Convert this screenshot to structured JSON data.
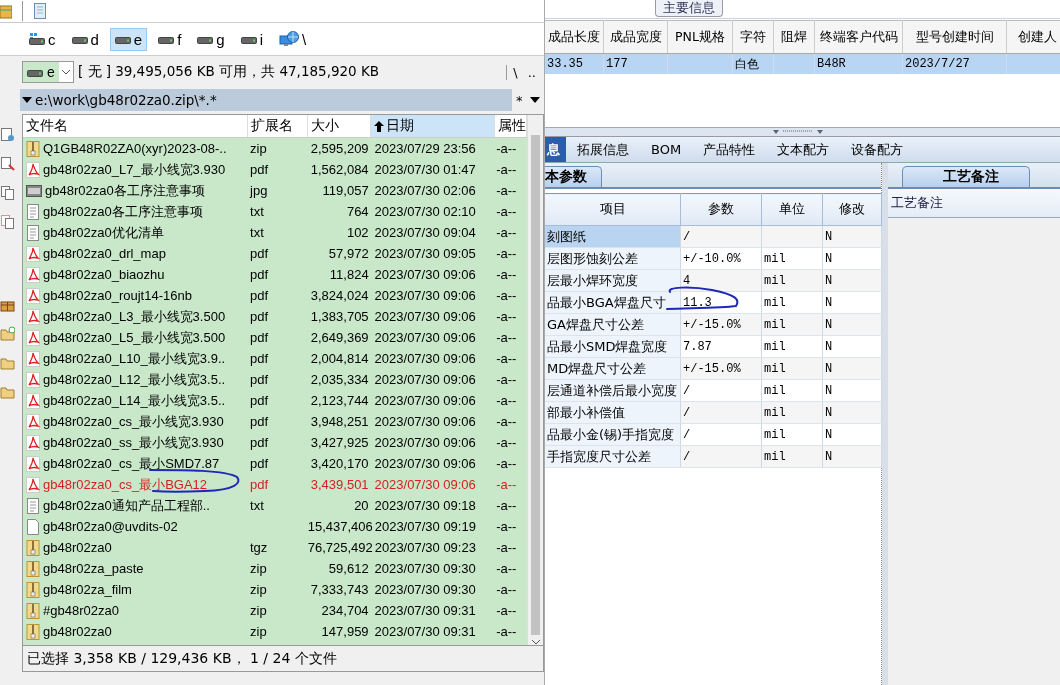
{
  "file_manager": {
    "drives": [
      {
        "label": "c",
        "kind": "system",
        "selected": false
      },
      {
        "label": "d",
        "kind": "disk",
        "selected": false
      },
      {
        "label": "e",
        "kind": "disk",
        "selected": true
      },
      {
        "label": "f",
        "kind": "disk",
        "selected": false
      },
      {
        "label": "g",
        "kind": "disk",
        "selected": false
      },
      {
        "label": "i",
        "kind": "disk",
        "selected": false
      },
      {
        "label": "\\",
        "kind": "network",
        "selected": false
      }
    ],
    "drive_combo": "e",
    "volume_label": "[ 无 ]",
    "free_space": "39,495,056 KB 可用，共 47,185,920 KB",
    "root_button": "\\",
    "up_button": "..",
    "path": "e:\\work\\gb48r02za0.zip\\*.*",
    "filter_button": "*",
    "columns": [
      {
        "label": "文件名",
        "sorted": false
      },
      {
        "label": "扩展名",
        "sorted": false
      },
      {
        "label": "大小",
        "sorted": false
      },
      {
        "label": "日期",
        "sorted": true
      },
      {
        "label": "属性",
        "sorted": false
      }
    ],
    "files": [
      {
        "kind": "archive",
        "name": "Q1GB48R02ZA0(xyr)2023-08-..",
        "ext": "zip",
        "size": "2,595,209",
        "date": "2023/07/29 23:56",
        "attr": "-a--",
        "marked": false
      },
      {
        "kind": "pdf",
        "name": "gb48r02za0_L7_最小线宽3.930",
        "ext": "pdf",
        "size": "1,562,084",
        "date": "2023/07/30 01:47",
        "attr": "-a--",
        "marked": false
      },
      {
        "kind": "image",
        "name": "gb48r02za0各工序注意事项",
        "ext": "jpg",
        "size": "119,057",
        "date": "2023/07/30 02:06",
        "attr": "-a--",
        "marked": false
      },
      {
        "kind": "text",
        "name": "gb48r02za0各工序注意事项",
        "ext": "txt",
        "size": "764",
        "date": "2023/07/30 02:10",
        "attr": "-a--",
        "marked": false
      },
      {
        "kind": "text",
        "name": "gb48r02za0优化清单",
        "ext": "txt",
        "size": "102",
        "date": "2023/07/30 09:04",
        "attr": "-a--",
        "marked": false
      },
      {
        "kind": "pdf",
        "name": "gb48r02za0_drl_map",
        "ext": "pdf",
        "size": "57,972",
        "date": "2023/07/30 09:05",
        "attr": "-a--",
        "marked": false
      },
      {
        "kind": "pdf",
        "name": "gb48r02za0_biaozhu",
        "ext": "pdf",
        "size": "11,824",
        "date": "2023/07/30 09:06",
        "attr": "-a--",
        "marked": false
      },
      {
        "kind": "pdf",
        "name": "gb48r02za0_roujt14-16nb",
        "ext": "pdf",
        "size": "3,824,024",
        "date": "2023/07/30 09:06",
        "attr": "-a--",
        "marked": false
      },
      {
        "kind": "pdf",
        "name": "gb48r02za0_L3_最小线宽3.500",
        "ext": "pdf",
        "size": "1,383,705",
        "date": "2023/07/30 09:06",
        "attr": "-a--",
        "marked": false
      },
      {
        "kind": "pdf",
        "name": "gb48r02za0_L5_最小线宽3.500",
        "ext": "pdf",
        "size": "2,649,369",
        "date": "2023/07/30 09:06",
        "attr": "-a--",
        "marked": false
      },
      {
        "kind": "pdf",
        "name": "gb48r02za0_L10_最小线宽3.9..",
        "ext": "pdf",
        "size": "2,004,814",
        "date": "2023/07/30 09:06",
        "attr": "-a--",
        "marked": false
      },
      {
        "kind": "pdf",
        "name": "gb48r02za0_L12_最小线宽3.5..",
        "ext": "pdf",
        "size": "2,035,334",
        "date": "2023/07/30 09:06",
        "attr": "-a--",
        "marked": false
      },
      {
        "kind": "pdf",
        "name": "gb48r02za0_L14_最小线宽3.5..",
        "ext": "pdf",
        "size": "2,123,744",
        "date": "2023/07/30 09:06",
        "attr": "-a--",
        "marked": false
      },
      {
        "kind": "pdf",
        "name": "gb48r02za0_cs_最小线宽3.930",
        "ext": "pdf",
        "size": "3,948,251",
        "date": "2023/07/30 09:06",
        "attr": "-a--",
        "marked": false
      },
      {
        "kind": "pdf",
        "name": "gb48r02za0_ss_最小线宽3.930",
        "ext": "pdf",
        "size": "3,427,925",
        "date": "2023/07/30 09:06",
        "attr": "-a--",
        "marked": false
      },
      {
        "kind": "pdf",
        "name": "gb48r02za0_cs_最小SMD7.87",
        "ext": "pdf",
        "size": "3,420,170",
        "date": "2023/07/30 09:06",
        "attr": "-a--",
        "marked": false
      },
      {
        "kind": "pdf",
        "name": "gb48r02za0_cs_最小BGA12",
        "ext": "pdf",
        "size": "3,439,501",
        "date": "2023/07/30 09:06",
        "attr": "-a--",
        "marked": true
      },
      {
        "kind": "text",
        "name": "gb48r02za0通知产品工程部..",
        "ext": "txt",
        "size": "20",
        "date": "2023/07/30 09:18",
        "attr": "-a--",
        "marked": false
      },
      {
        "kind": "blank",
        "name": "gb48r02za0@uvdits-02",
        "size": "15,437,406",
        "date": "2023/07/30 09:19",
        "attr": "-a--",
        "marked": false
      },
      {
        "kind": "archive",
        "name": "gb48r02za0",
        "ext": "tgz",
        "size": "76,725,492",
        "date": "2023/07/30 09:23",
        "attr": "-a--",
        "marked": false
      },
      {
        "kind": "archive",
        "name": "gb48r02za_paste",
        "ext": "zip",
        "size": "59,612",
        "date": "2023/07/30 09:30",
        "attr": "-a--",
        "marked": false
      },
      {
        "kind": "archive",
        "name": "gb48r02za_film",
        "ext": "zip",
        "size": "7,333,743",
        "date": "2023/07/30 09:30",
        "attr": "-a--",
        "marked": false
      },
      {
        "kind": "archive",
        "name": "#gb48r02za0",
        "ext": "zip",
        "size": "234,704",
        "date": "2023/07/30 09:31",
        "attr": "-a--",
        "marked": false
      },
      {
        "kind": "archive",
        "name": "gb48r02za0",
        "ext": "zip",
        "size": "147,959",
        "date": "2023/07/30 09:31",
        "attr": "-a--",
        "marked": false
      }
    ],
    "status_bar": "已选择 3,358 KB / 129,436 KB， 1 / 24 个文件"
  },
  "product": {
    "group_title": "主要信息",
    "columns": [
      "成品长度",
      "成品宽度",
      "PNL规格",
      "字符",
      "阻焊",
      "终端客户代码",
      "型号创建时间",
      "创建人"
    ],
    "rows": [
      {
        "cells": [
          "33.35",
          "177",
          null,
          "白色",
          null,
          "B48R",
          "2023/7/27",
          null
        ],
        "selected": true
      }
    ],
    "tabs": [
      {
        "label": "息",
        "selected": true
      },
      {
        "label": "拓展信息",
        "selected": false
      },
      {
        "label": "BOM",
        "selected": false
      },
      {
        "label": "产品特性",
        "selected": false
      },
      {
        "label": "文本配方",
        "selected": false
      },
      {
        "label": "设备配方",
        "selected": false
      }
    ],
    "params_tab": "本参数",
    "param_columns": [
      "项目",
      "参数",
      "单位",
      "修改"
    ],
    "params": [
      {
        "item": "刻图纸",
        "value": "/",
        "modified": "N",
        "selected": true
      },
      {
        "item": "层图形蚀刻公差",
        "value": "+/-10.0%",
        "unit": "mil",
        "modified": "N",
        "selected": false
      },
      {
        "item": "层最小焊环宽度",
        "value": "4",
        "unit": "mil",
        "modified": "N",
        "selected": false
      },
      {
        "item": "品最小BGA焊盘尺寸",
        "value": "11.3",
        "unit": "mil",
        "modified": "N",
        "selected": false
      },
      {
        "item": "GA焊盘尺寸公差",
        "value": "+/-15.0%",
        "unit": "mil",
        "modified": "N",
        "selected": false
      },
      {
        "item": "品最小SMD焊盘宽度",
        "value": "7.87",
        "unit": "mil",
        "modified": "N",
        "selected": false
      },
      {
        "item": "MD焊盘尺寸公差",
        "value": "+/-15.0%",
        "unit": "mil",
        "modified": "N",
        "selected": false
      },
      {
        "item": "层通道补偿后最小宽度",
        "value": "/",
        "unit": "mil",
        "modified": "N",
        "selected": false
      },
      {
        "item": "部最小补偿值",
        "value": "/",
        "unit": "mil",
        "modified": "N",
        "selected": false
      },
      {
        "item": "品最小金(锡)手指宽度",
        "value": "/",
        "unit": "mil",
        "modified": "N",
        "selected": false
      },
      {
        "item": "手指宽度尺寸公差",
        "value": "/",
        "unit": "mil",
        "modified": "N",
        "selected": false
      }
    ],
    "notes_tab": "工艺备注",
    "notes_label": "工艺备注"
  },
  "annotations": [
    {
      "kind": "circle"
    },
    {
      "kind": "underline"
    }
  ]
}
